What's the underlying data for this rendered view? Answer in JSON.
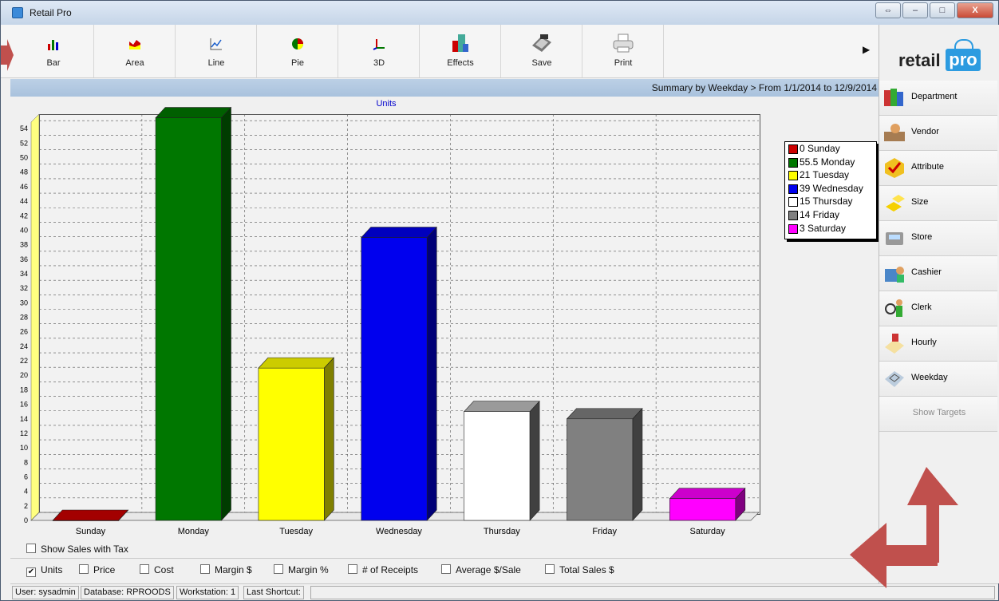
{
  "window": {
    "title": "Retail Pro",
    "buttons": [
      "⇔",
      "–",
      "□",
      "X"
    ]
  },
  "toolbar": {
    "buttons": [
      {
        "label": "Bar",
        "icon": "bar-chart-icon"
      },
      {
        "label": "Area",
        "icon": "area-chart-icon"
      },
      {
        "label": "Line",
        "icon": "line-chart-icon"
      },
      {
        "label": "Pie",
        "icon": "pie-chart-icon"
      },
      {
        "label": "3D",
        "icon": "3d-axes-icon"
      },
      {
        "label": "Effects",
        "icon": "effects-icon"
      },
      {
        "label": "Save",
        "icon": "save-icon"
      },
      {
        "label": "Print",
        "icon": "print-icon"
      }
    ]
  },
  "summary": "Summary by Weekday > From 1/1/2014 to 12/9/2014",
  "sidebar": {
    "logo": {
      "retail": "retail",
      "pro": "pro"
    },
    "items": [
      {
        "label": "Department",
        "icon": "department-icon"
      },
      {
        "label": "Vendor",
        "icon": "vendor-icon"
      },
      {
        "label": "Attribute",
        "icon": "attribute-icon"
      },
      {
        "label": "Size",
        "icon": "size-icon"
      },
      {
        "label": "Store",
        "icon": "store-icon"
      },
      {
        "label": "Cashier",
        "icon": "cashier-icon"
      },
      {
        "label": "Clerk",
        "icon": "clerk-icon"
      },
      {
        "label": "Hourly",
        "icon": "hourly-icon"
      },
      {
        "label": "Weekday",
        "icon": "weekday-icon"
      },
      {
        "label": "Show Targets",
        "icon": ""
      }
    ]
  },
  "options": {
    "show_sales_with_tax": {
      "label": "Show Sales with Tax",
      "checked": false
    },
    "metrics": [
      {
        "label": "Units",
        "checked": true
      },
      {
        "label": "Price",
        "checked": false
      },
      {
        "label": "Cost",
        "checked": false
      },
      {
        "label": "Margin $",
        "checked": false
      },
      {
        "label": "Margin %",
        "checked": false
      },
      {
        "label": "# of Receipts",
        "checked": false
      },
      {
        "label": "Average $/Sale",
        "checked": false
      },
      {
        "label": "Total Sales $",
        "checked": false
      }
    ]
  },
  "statusbar": {
    "user": "User: sysadmin",
    "database": "Database: RPROODS",
    "workstation": "Workstation: 1",
    "last_shortcut": "Last Shortcut:"
  },
  "chart_data": {
    "type": "bar",
    "title": "Units",
    "categories": [
      "Sunday",
      "Monday",
      "Tuesday",
      "Wednesday",
      "Thursday",
      "Friday",
      "Saturday"
    ],
    "values": [
      0,
      55.5,
      21,
      39,
      15,
      14,
      3
    ],
    "colors": [
      "#cc0000",
      "#007700",
      "#ffff00",
      "#0000ee",
      "#ffffff",
      "#808080",
      "#ff00ff"
    ],
    "legend": [
      "0 Sunday",
      "55.5 Monday",
      "21 Tuesday",
      "39 Wednesday",
      "15 Thursday",
      "14 Friday",
      "3 Saturday"
    ],
    "ylim": [
      0,
      56
    ],
    "yticks": [
      0,
      2,
      4,
      6,
      8,
      10,
      12,
      14,
      16,
      18,
      20,
      22,
      24,
      26,
      28,
      30,
      32,
      34,
      36,
      38,
      40,
      42,
      44,
      46,
      48,
      50,
      52,
      54
    ],
    "grid": true,
    "legend_position": "right"
  }
}
